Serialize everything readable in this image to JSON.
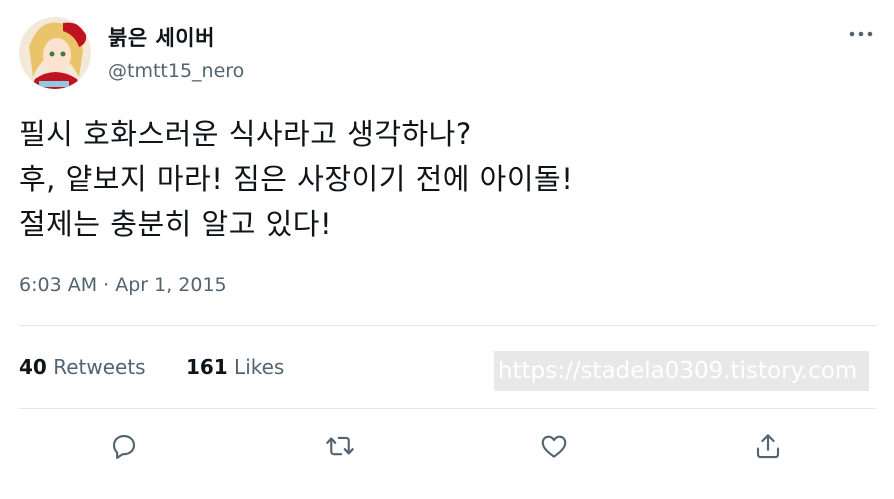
{
  "author": {
    "display_name": "붉은 세이버",
    "handle": "@tmtt15_nero"
  },
  "tweet": {
    "lines": [
      "필시 호화스러운 식사라고 생각하나?",
      "후, 얕보지 마라! 짐은 사장이기 전에 아이돌!",
      "절제는 충분히 알고 있다!"
    ],
    "timestamp": "6:03 AM · Apr 1, 2015"
  },
  "stats": {
    "retweets_count": "40",
    "retweets_label": "Retweets",
    "likes_count": "161",
    "likes_label": "Likes"
  },
  "watermark": "https://stadela0309.tistory.com",
  "icons": {
    "more": "more-horizontal-icon",
    "reply": "reply-icon",
    "retweet": "retweet-icon",
    "like": "like-icon",
    "share": "share-icon"
  },
  "colors": {
    "text": "#0f1419",
    "secondary": "#536471",
    "divider": "#e3e7ea"
  }
}
